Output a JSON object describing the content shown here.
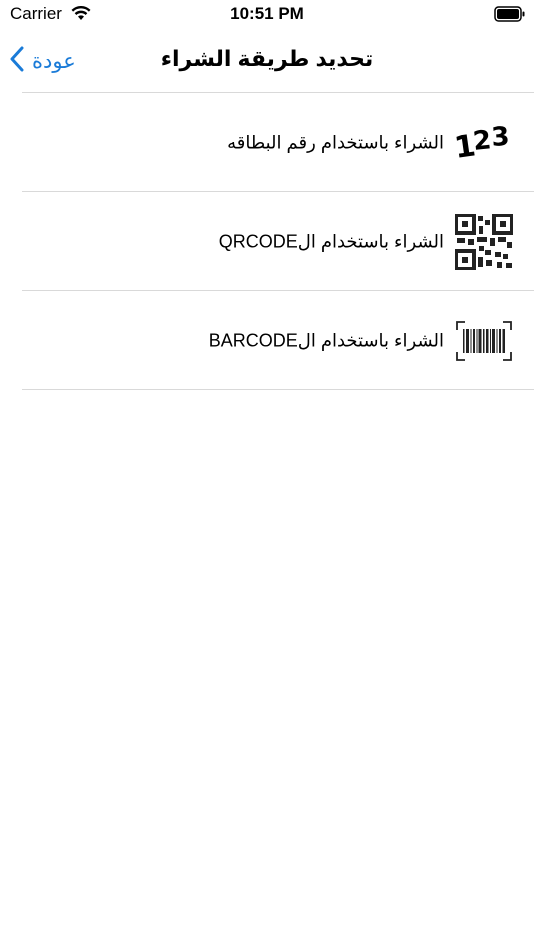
{
  "status_bar": {
    "carrier": "Carrier",
    "time": "10:51 PM",
    "icons": [
      "wifi-icon",
      "battery-icon"
    ]
  },
  "nav": {
    "title": "تحديد طريقة الشراء",
    "back_label": "عودة",
    "back_icon": "chevron-left-icon",
    "accent_color": "#1a7bd8"
  },
  "options": [
    {
      "label": "الشراء باستخدام رقم البطاقه",
      "icon": "digits-123-icon",
      "icon_text": "123"
    },
    {
      "label": "الشراء باستخدام الQRCODE",
      "icon": "qr-code-icon"
    },
    {
      "label": "الشراء باستخدام الBARCODE",
      "icon": "barcode-icon"
    }
  ]
}
